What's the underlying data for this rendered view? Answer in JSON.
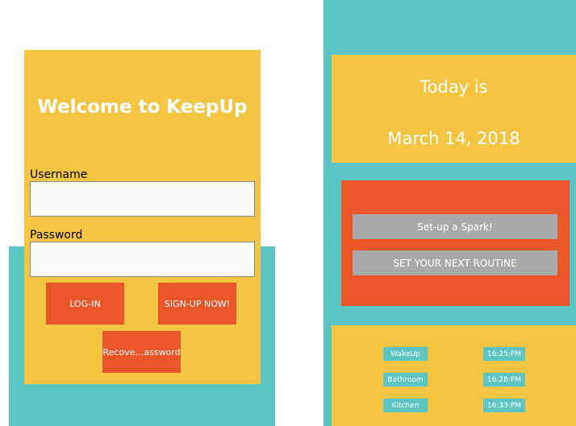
{
  "login": {
    "title": "Welcome to KeepUp",
    "username_label": "Username",
    "username_value": "",
    "password_label": "Password",
    "password_value": "",
    "login_button": "LOG-IN",
    "signup_button": "SIGN-UP NOW!",
    "recover_button": "Recove…assword"
  },
  "home": {
    "today_label": "Today is",
    "date": "March 14, 2018",
    "spark_button": "Set-up a Spark!",
    "routine_button": "SET YOUR NEXT ROUTINE",
    "routines": [
      {
        "name": "WakeUp",
        "time": "16:25:PM"
      },
      {
        "name": "Bathroom",
        "time": "16:28:PM"
      },
      {
        "name": "Kitchen",
        "time": "16:33:PM"
      }
    ]
  },
  "colors": {
    "teal": "#5cc5c4",
    "yellow": "#f4c542",
    "orange": "#ea5628",
    "gray": "#a9a9a9"
  }
}
